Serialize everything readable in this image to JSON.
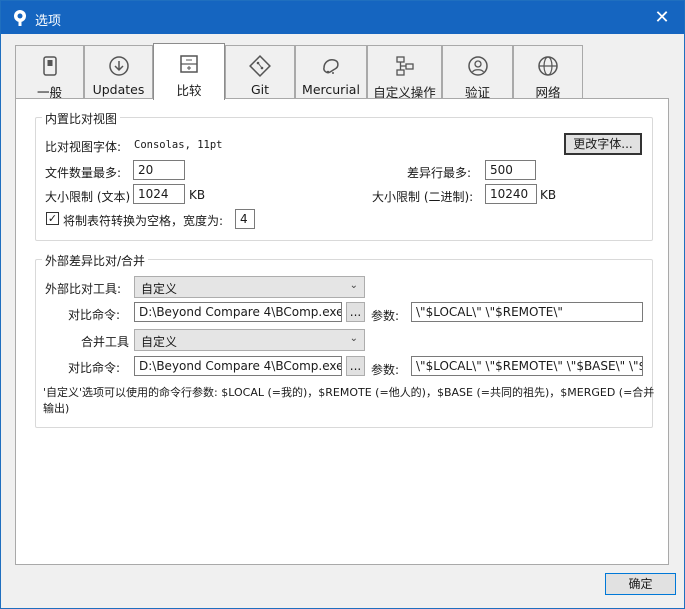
{
  "window": {
    "title": "选项",
    "close_glyph": "✕"
  },
  "tabs": [
    {
      "label": "一般",
      "icon": "switch-icon"
    },
    {
      "label": "Updates",
      "icon": "download-icon"
    },
    {
      "label": "比较",
      "icon": "compare-icon"
    },
    {
      "label": "Git",
      "icon": "git-icon"
    },
    {
      "label": "Mercurial",
      "icon": "mercurial-icon"
    },
    {
      "label": "自定义操作",
      "icon": "flow-icon"
    },
    {
      "label": "验证",
      "icon": "user-icon"
    },
    {
      "label": "网络",
      "icon": "globe-icon"
    }
  ],
  "active_tab": "比较",
  "builtin": {
    "title": "内置比对视图",
    "font_label": "比对视图字体:",
    "font_value": "Consolas, 11pt",
    "change_font_button": "更改字体...",
    "max_files_label": "文件数量最多:",
    "max_files_value": "20",
    "max_diff_lines_label": "差异行最多:",
    "max_diff_lines_value": "500",
    "size_limit_text_label": "大小限制 (文本)",
    "size_limit_text_value": "1024",
    "size_limit_text_unit": "KB",
    "size_limit_binary_label": "大小限制 (二进制):",
    "size_limit_binary_value": "10240",
    "size_limit_binary_unit": "KB",
    "tab_convert_checked": true,
    "tab_convert_label": "将制表符转换为空格，宽度为:",
    "tab_width_value": "4"
  },
  "external": {
    "title": "外部差异比对/合并",
    "diff_tool_label": "外部比对工具:",
    "diff_tool_value": "自定义",
    "diff_command_label": "对比命令:",
    "diff_command_value": "D:\\Beyond Compare 4\\BComp.exe",
    "browse_button": "...",
    "diff_args_label": "参数:",
    "diff_args_value": "\\\"$LOCAL\\\" \\\"$REMOTE\\\"",
    "merge_tool_label": "合并工具",
    "merge_tool_value": "自定义",
    "merge_command_label": "对比命令:",
    "merge_command_value": "D:\\Beyond Compare 4\\BComp.exe",
    "merge_args_label": "参数:",
    "merge_args_value": "\\\"$LOCAL\\\" \\\"$REMOTE\\\" \\\"$BASE\\\" \\\"$",
    "help_line1": "'自定义'选项可以使用的命令行参数: $LOCAL (=我的)，$REMOTE (=他人的)，$BASE (=共同的祖先)，$MERGED (=合并",
    "help_line2": "输出)"
  },
  "ok_button": "确定",
  "colors": {
    "titlebar": "#1565c0",
    "accent": "#0078d7"
  }
}
